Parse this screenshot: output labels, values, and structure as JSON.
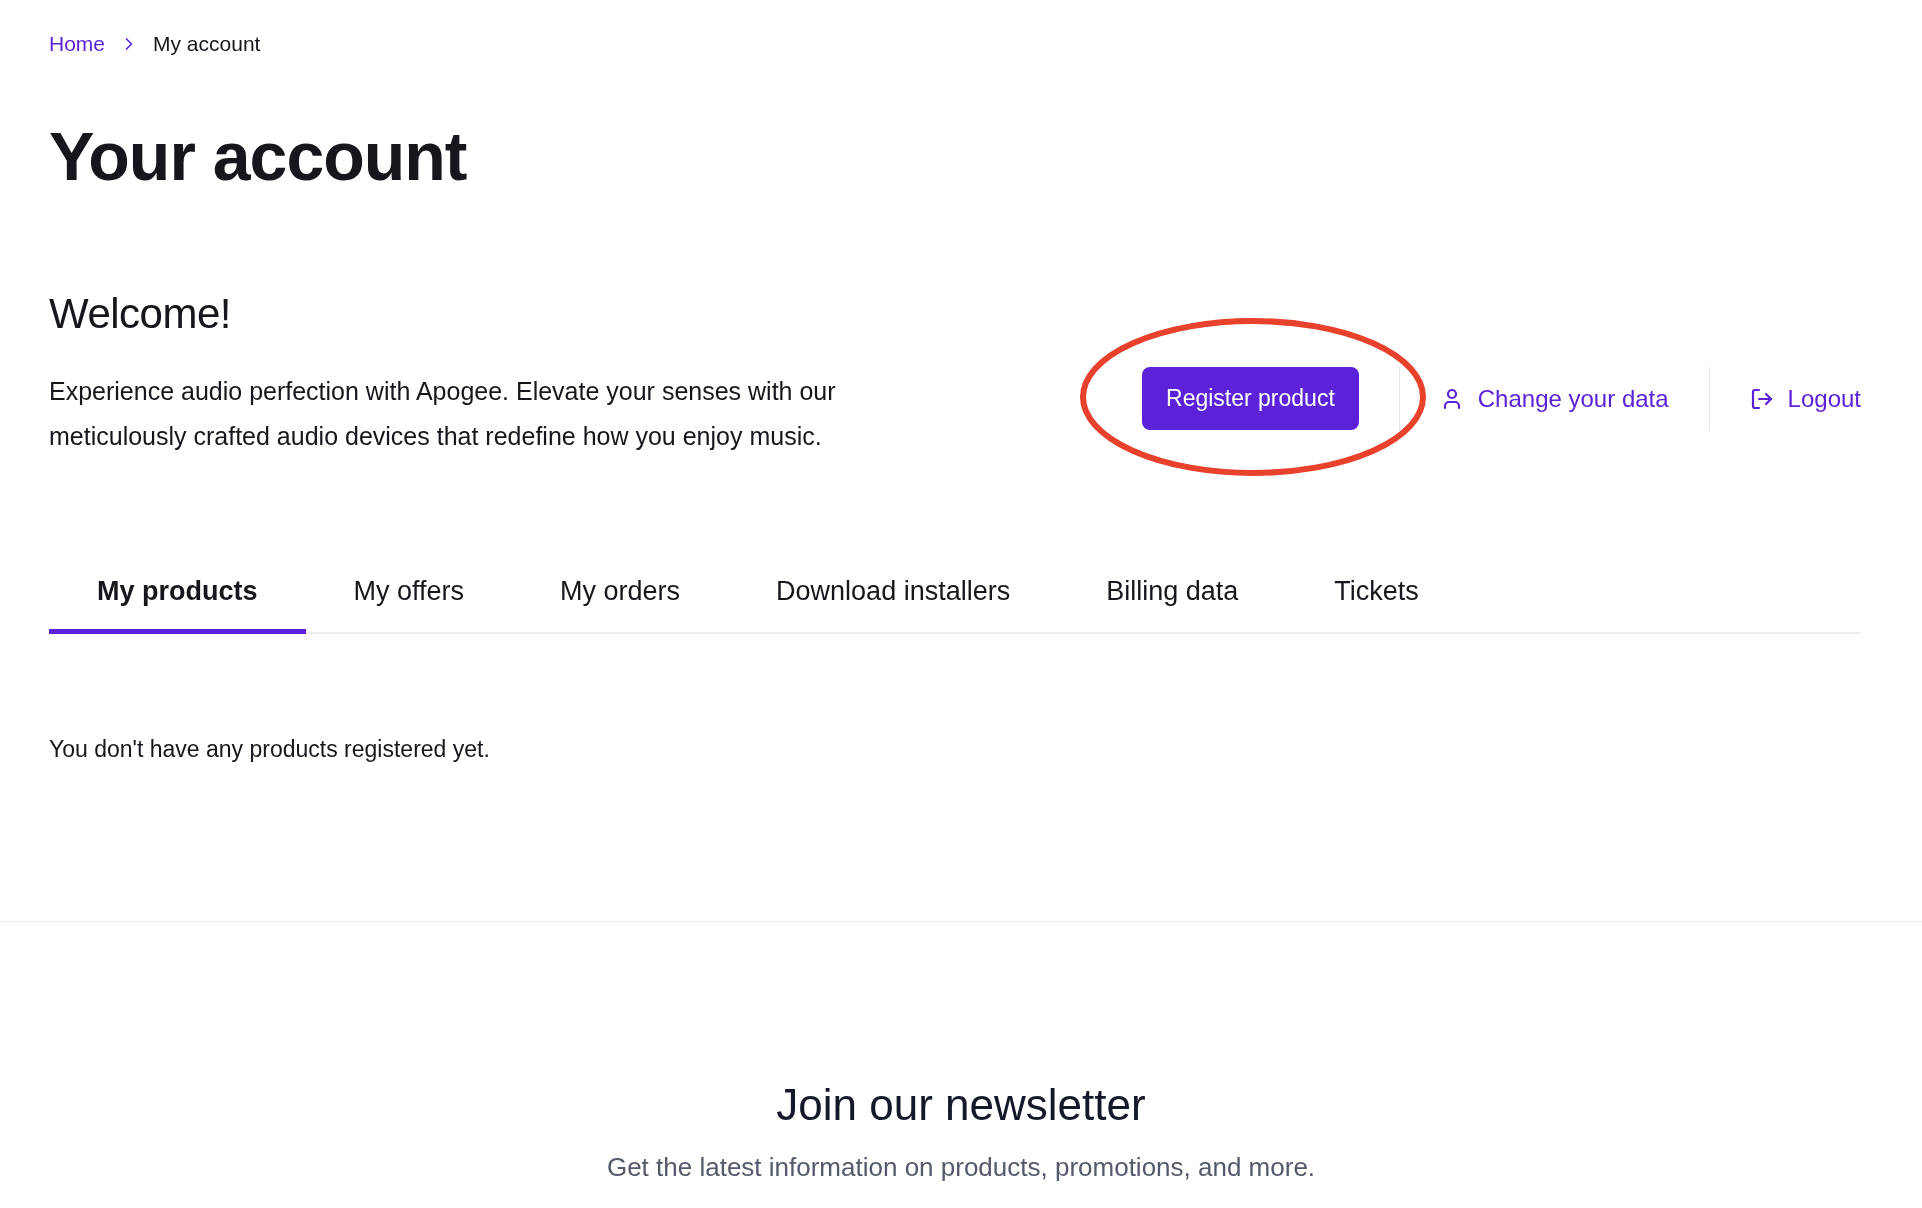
{
  "breadcrumb": [
    {
      "label": "Home",
      "current": false
    },
    {
      "label": "My account",
      "current": true
    }
  ],
  "page_title": "Your account",
  "welcome": {
    "heading": "Welcome!",
    "text": "Experience audio perfection with Apogee. Elevate your senses with our meticulously crafted audio devices that redefine how you enjoy music."
  },
  "actions": {
    "primary": "Register product",
    "links": [
      {
        "label": "Change your data",
        "kind": "user"
      },
      {
        "label": "Logout",
        "kind": "logout"
      }
    ]
  },
  "tabs": [
    {
      "label": "My products",
      "selected": true
    },
    {
      "label": "My offers",
      "selected": false
    },
    {
      "label": "My orders",
      "selected": false
    },
    {
      "label": "Download installers",
      "selected": false
    },
    {
      "label": "Billing data",
      "selected": false
    },
    {
      "label": "Tickets",
      "selected": false
    }
  ],
  "empty_message": "You don't have any products registered yet.",
  "newsletter": {
    "title": "Join our newsletter",
    "subtitle": "Get the latest information on products, promotions, and more."
  }
}
